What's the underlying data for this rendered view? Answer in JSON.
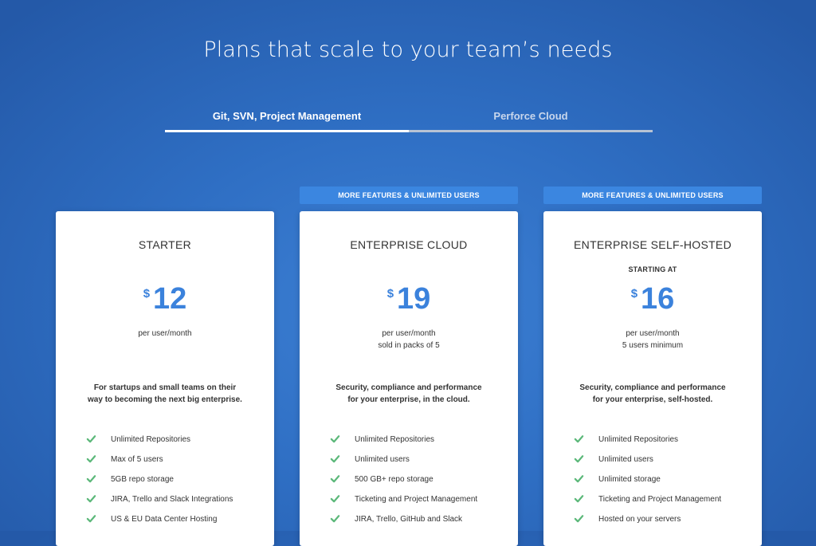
{
  "page": {
    "title": "Plans that scale to your team’s needs"
  },
  "tabs": [
    {
      "label": "Git, SVN, Project Management",
      "active": true
    },
    {
      "label": "Perforce Cloud",
      "active": false
    }
  ],
  "colors": {
    "accent": "#3b82dc",
    "check": "#5cb87a",
    "ribbon": "#3b86e0"
  },
  "plans": [
    {
      "ribbon": "",
      "name": "STARTER",
      "starting_at": "",
      "currency": "$",
      "price": "12",
      "unit_line1": "per user/month",
      "unit_line2": "",
      "desc_line1": "For startups and small teams on their",
      "desc_line2": "way to becoming the next big enterprise.",
      "features": [
        "Unlimited Repositories",
        "Max of 5 users",
        "5GB repo storage",
        "JIRA, Trello and Slack Integrations",
        "US & EU Data Center Hosting"
      ]
    },
    {
      "ribbon": "MORE FEATURES & UNLIMITED USERS",
      "name": "ENTERPRISE CLOUD",
      "starting_at": "",
      "currency": "$",
      "price": "19",
      "unit_line1": "per user/month",
      "unit_line2": "sold in packs of 5",
      "desc_line1": "Security, compliance and performance",
      "desc_line2": "for your enterprise, in the cloud.",
      "features": [
        "Unlimited Repositories",
        "Unlimited users",
        "500 GB+ repo storage",
        "Ticketing and Project Management",
        "JIRA, Trello, GitHub and Slack"
      ]
    },
    {
      "ribbon": "MORE FEATURES & UNLIMITED USERS",
      "name": "ENTERPRISE SELF-HOSTED",
      "starting_at": "STARTING AT",
      "currency": "$",
      "price": "16",
      "unit_line1": "per user/month",
      "unit_line2": "5 users minimum",
      "desc_line1": "Security, compliance and performance",
      "desc_line2": "for your enterprise, self-hosted.",
      "features": [
        "Unlimited Repositories",
        "Unlimited users",
        "Unlimited storage",
        "Ticketing and Project Management",
        "Hosted on your servers"
      ]
    }
  ]
}
